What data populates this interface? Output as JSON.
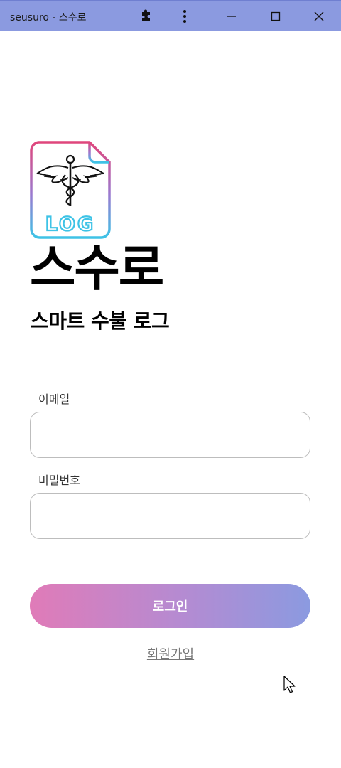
{
  "window": {
    "title": "seusuro - 스수로"
  },
  "app": {
    "title": "스수로",
    "subtitle": "스마트 수불 로그",
    "logo_text": "LOG"
  },
  "form": {
    "email_label": "이메일",
    "email_value": "",
    "password_label": "비밀번호",
    "password_value": "",
    "login_label": "로그인",
    "signup_label": "회원가입"
  },
  "colors": {
    "titlebar": "#8b9ae0",
    "button_start": "#e07bb8",
    "button_end": "#8b9ae0",
    "logo_top": "#e0457b",
    "logo_bottom": "#3ec3e6"
  }
}
